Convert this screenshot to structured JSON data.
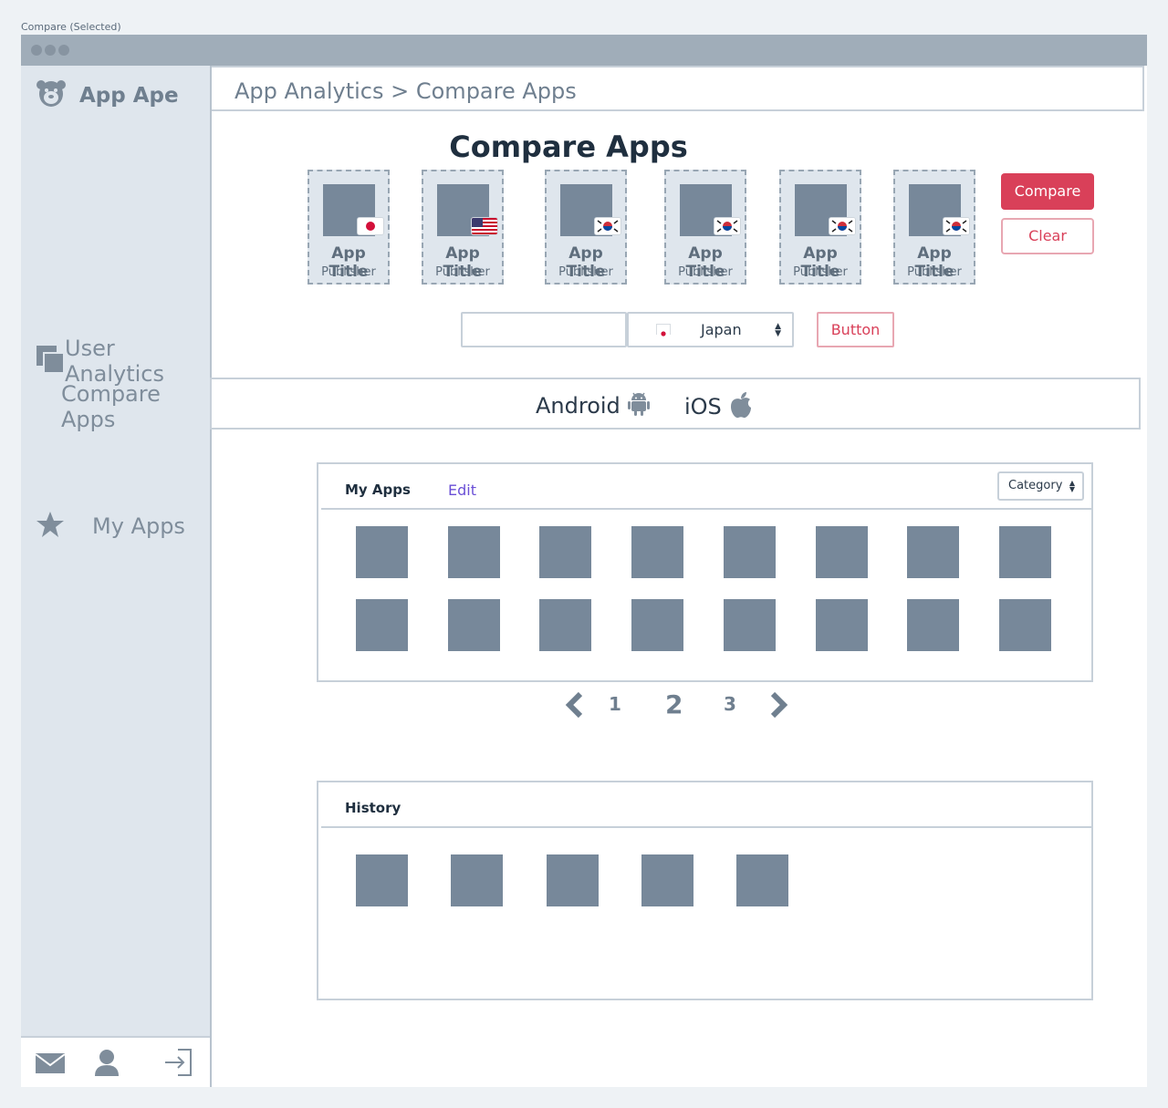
{
  "frame_label": "Compare (Selected)",
  "sidebar": {
    "brand": "App Ape",
    "nav_user_analytics": "User Analytics",
    "nav_compare_apps": "Compare Apps",
    "nav_my_apps": "My Apps",
    "footer_icons": [
      "mail-icon",
      "user-icon",
      "logout-icon"
    ]
  },
  "header": {
    "breadcrumb": "App Analytics > Compare Apps"
  },
  "main": {
    "title": "Compare Apps",
    "slots": [
      {
        "title": "App Title",
        "publisher": "Publisher",
        "flag": "japan"
      },
      {
        "title": "App Title",
        "publisher": "Publisher",
        "flag": "usa"
      },
      {
        "title": "App Title",
        "publisher": "Publisher",
        "flag": "korea"
      },
      {
        "title": "App Title",
        "publisher": "Publisher",
        "flag": "korea"
      },
      {
        "title": "App Title",
        "publisher": "Publisher",
        "flag": "korea"
      },
      {
        "title": "App Title",
        "publisher": "Publisher",
        "flag": "korea"
      }
    ],
    "compare_button": "Compare",
    "clear_button": "Clear",
    "search_value": "",
    "country": "Japan",
    "action_button": "Button",
    "platforms": {
      "android": "Android",
      "ios": "iOS"
    }
  },
  "my_apps": {
    "title": "My Apps",
    "edit": "Edit",
    "category": "Category",
    "thumb_count": 16
  },
  "pager": {
    "pages": [
      "1",
      "2",
      "3"
    ],
    "current": "2"
  },
  "history": {
    "title": "History",
    "thumb_count": 5
  },
  "colors": {
    "accent": "#d94059",
    "sidebar_bg": "#dfe6ed",
    "placeholder": "#77889a",
    "link": "#6a4fd6"
  }
}
